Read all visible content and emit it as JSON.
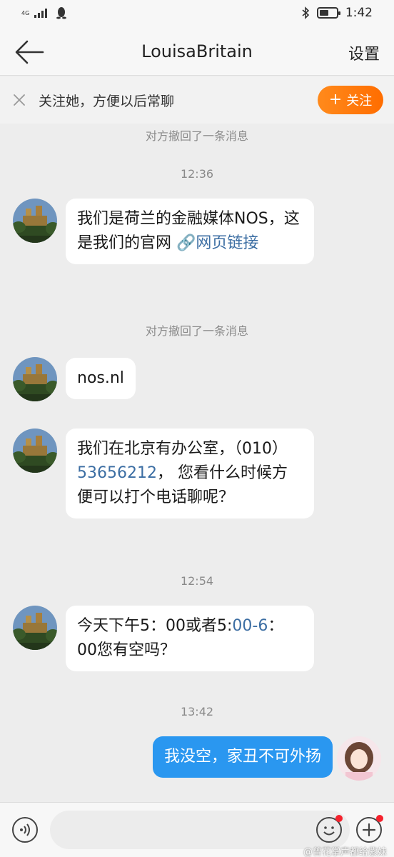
{
  "status_bar": {
    "network": "4G",
    "time": "1:42",
    "icons": [
      "signal-icon",
      "qq-penguin-icon",
      "bluetooth-icon",
      "battery-icon"
    ],
    "battery_level": 0.55
  },
  "header": {
    "back_icon": "back-arrow-icon",
    "title": "LouisaBritain",
    "settings_label": "设置"
  },
  "follow_banner": {
    "text": "关注她，方便以后常聊",
    "button_label": "关注",
    "button_icon": "plus-icon",
    "accent_color": "#ff7a10"
  },
  "chat": {
    "notes": {
      "recall_1": "对方撤回了一条消息",
      "recall_2": "对方撤回了一条消息"
    },
    "timestamps": {
      "t1": "12:36",
      "t2": "12:54",
      "t3": "13:42"
    },
    "messages": {
      "m1_text": "我们是荷兰的金融媒体NOS，这是我们的官网",
      "m1_link": "网页链接",
      "m2_text": "nos.nl",
      "m3_prefix": "我们在北京有办公室，（010）",
      "m3_phone": "53656212",
      "m3_suffix": "， 您看什么时候方便可以打个电话聊呢？",
      "m4_prefix": "今天下午5：00或者5:",
      "m4_link": "00-6",
      "m4_suffix": "：00您有空吗？",
      "mine_text": "我没空，家丑不可外扬"
    },
    "incoming_bubble_color": "#ffffff",
    "outgoing_bubble_color": "#2a97f0"
  },
  "input_bar": {
    "placeholder": "",
    "voice_icon": "voice-icon",
    "emoji_icon": "emoji-icon",
    "add_icon": "plus-circle-icon",
    "watermark": "@曾花掌声都给紫妹"
  }
}
